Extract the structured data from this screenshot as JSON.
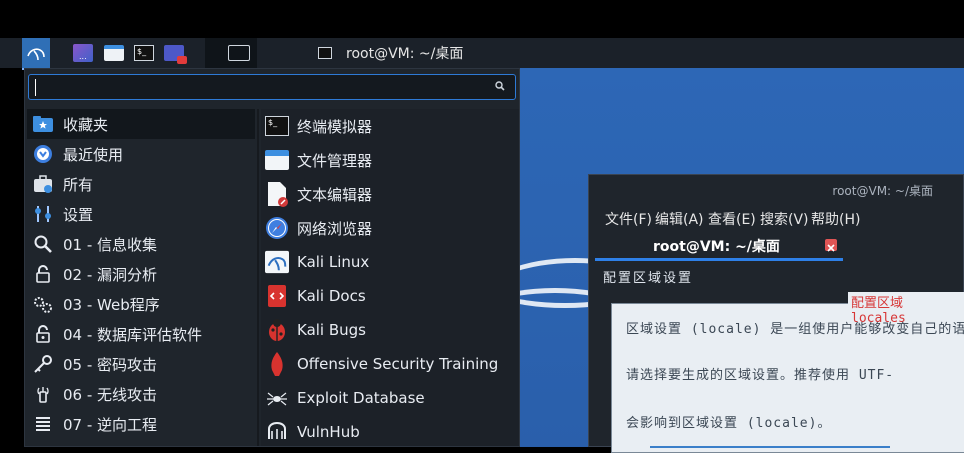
{
  "taskbar": {
    "active_window_title": "root@VM: ~/桌面"
  },
  "search": {
    "value": "",
    "placeholder": ""
  },
  "categories": [
    {
      "label": "收藏夹",
      "icon": "star-folder-icon"
    },
    {
      "label": "最近使用",
      "icon": "recent-icon"
    },
    {
      "label": "所有",
      "icon": "briefcase-icon"
    },
    {
      "label": "设置",
      "icon": "settings-sliders-icon"
    },
    {
      "label": "01 - 信息收集",
      "icon": "magnifier-icon"
    },
    {
      "label": "02 - 漏洞分析",
      "icon": "lock-icon"
    },
    {
      "label": "03 - Web程序",
      "icon": "gears-icon"
    },
    {
      "label": "04 - 数据库评估软件",
      "icon": "unlock-icon"
    },
    {
      "label": "05 - 密码攻击",
      "icon": "key-icon"
    },
    {
      "label": "06 - 无线攻击",
      "icon": "wireless-icon"
    },
    {
      "label": "07 - 逆向工程",
      "icon": "spring-icon"
    }
  ],
  "apps": [
    {
      "label": "终端模拟器",
      "icon": "terminal-icon"
    },
    {
      "label": "文件管理器",
      "icon": "folder-icon"
    },
    {
      "label": "文本编辑器",
      "icon": "text-editor-icon"
    },
    {
      "label": "网络浏览器",
      "icon": "web-browser-icon"
    },
    {
      "label": "Kali Linux",
      "icon": "kali-linux-icon"
    },
    {
      "label": "Kali Docs",
      "icon": "kali-docs-icon"
    },
    {
      "label": "Kali Bugs",
      "icon": "kali-bugs-icon"
    },
    {
      "label": "Offensive Security Training",
      "icon": "offsec-icon"
    },
    {
      "label": "Exploit Database",
      "icon": "exploit-db-icon"
    },
    {
      "label": "VulnHub",
      "icon": "vulnhub-icon"
    }
  ],
  "terminal": {
    "window_title": "root@VM: ~/桌面",
    "menus": [
      "文件(F)",
      "编辑(A)",
      "查看(E)",
      "搜索(V)",
      "帮助(H)"
    ],
    "tab_label": "root@VM: ~/桌面",
    "prompt_line": "配置区域设置",
    "dialog_title": "配置区域 locales",
    "dialog_line1": "区域设置 (locale) 是一组使用户能够改变自己的语言",
    "dialog_line2": "请选择要生成的区域设置。推荐使用 UTF-",
    "dialog_line3": "会影响到区域设置 (locale)。"
  },
  "colors": {
    "accent": "#2e80e8",
    "desktop": "#2d67b6",
    "panel": "#1f252c",
    "close": "#e05555"
  }
}
